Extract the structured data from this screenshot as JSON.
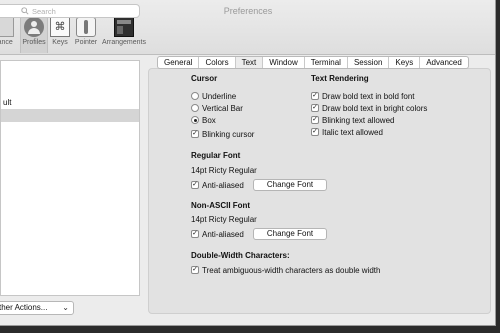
{
  "window": {
    "title": "Preferences"
  },
  "toolbar": {
    "items": [
      {
        "label": "Appearance",
        "shown": "rance"
      },
      {
        "label": "Profiles"
      },
      {
        "label": "Keys"
      },
      {
        "label": "Pointer"
      },
      {
        "label": "Arrangements"
      }
    ]
  },
  "sidebar": {
    "search_placeholder": "Search",
    "profiles": [
      "ult",
      ""
    ],
    "other_actions": "ther Actions...",
    "other_actions_chevron": "⌄"
  },
  "tabs": [
    "General",
    "Colors",
    "Text",
    "Window",
    "Terminal",
    "Session",
    "Keys",
    "Advanced"
  ],
  "active_tab": "Text",
  "cursor": {
    "heading": "Cursor",
    "options": [
      "Underline",
      "Vertical Bar",
      "Box"
    ],
    "selected": "Box",
    "blinking_label": "Blinking cursor"
  },
  "text_rendering": {
    "heading": "Text Rendering",
    "options": [
      "Draw bold text in bold font",
      "Draw bold text in bright colors",
      "Blinking text allowed",
      "Italic text allowed"
    ]
  },
  "regular_font": {
    "heading": "Regular Font",
    "font_name": "14pt Ricty Regular",
    "anti_aliased_label": "Anti-aliased",
    "change_font_label": "Change Font"
  },
  "non_ascii_font": {
    "heading": "Non-ASCII Font",
    "font_name": "14pt Ricty Regular",
    "anti_aliased_label": "Anti-aliased",
    "change_font_label": "Change Font"
  },
  "double_width": {
    "heading": "Double-Width Characters:",
    "option": "Treat ambiguous-width characters as double width"
  },
  "check_glyph": "✓"
}
